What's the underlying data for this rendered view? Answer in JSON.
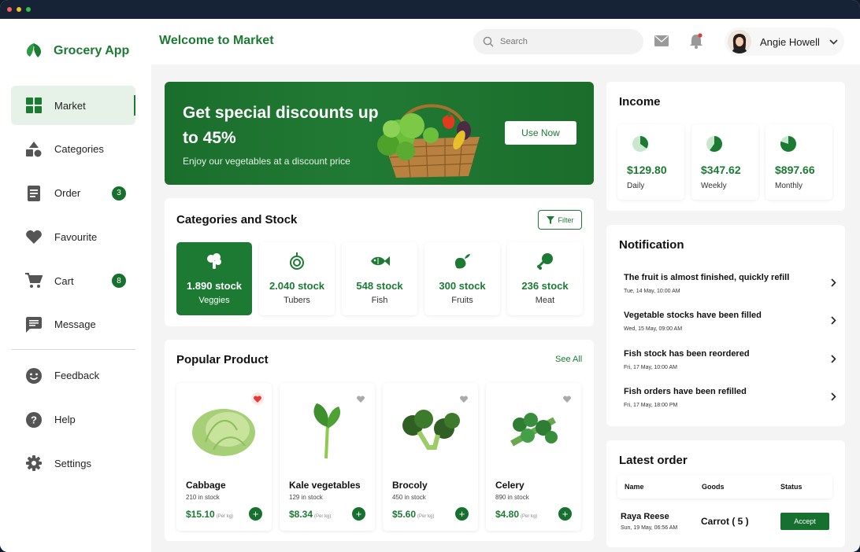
{
  "window": {
    "dots": [
      "#ff5f57",
      "#febc2e",
      "#28c840"
    ]
  },
  "brand": {
    "name": "Grocery App",
    "color": "#1c7a33",
    "logo_icon": "leaf-icon"
  },
  "sidebar": {
    "items": [
      {
        "label": "Market",
        "icon": "grid-icon",
        "active": true
      },
      {
        "label": "Categories",
        "icon": "shapes-icon"
      },
      {
        "label": "Order",
        "icon": "document-icon",
        "badge": "3"
      },
      {
        "label": "Favourite",
        "icon": "heart-icon"
      },
      {
        "label": "Cart",
        "icon": "cart-icon",
        "badge": "8"
      },
      {
        "label": "Message",
        "icon": "message-icon"
      }
    ],
    "bottom_items": [
      {
        "label": "Feedback",
        "icon": "smiley-icon"
      },
      {
        "label": "Help",
        "icon": "help-icon"
      },
      {
        "label": "Settings",
        "icon": "gear-icon"
      }
    ]
  },
  "header": {
    "title": "Welcome to Market",
    "search_placeholder": "Search",
    "user_name": "Angie Howell"
  },
  "banner": {
    "title": "Get special discounts up to 45%",
    "subtitle": "Enjoy our vegetables at a discount price",
    "button": "Use Now"
  },
  "categories": {
    "title": "Categories and Stock",
    "filter_label": "Filter",
    "items": [
      {
        "value": "1.890 stock",
        "name": "Veggies",
        "icon": "broccoli-icon",
        "active": true
      },
      {
        "value": "2.040 stock",
        "name": "Tubers",
        "icon": "onion-icon"
      },
      {
        "value": "548 stock",
        "name": "Fish",
        "icon": "fish-icon"
      },
      {
        "value": "300 stock",
        "name": "Fruits",
        "icon": "apple-icon"
      },
      {
        "value": "236 stock",
        "name": "Meat",
        "icon": "drumstick-icon"
      }
    ]
  },
  "popular": {
    "title": "Popular Product",
    "see_all": "See All",
    "products": [
      {
        "name": "Cabbage",
        "stock": "210 in stock",
        "price": "$15.10",
        "unit": "(Per kg)",
        "favourite": true,
        "image": "cabbage-image"
      },
      {
        "name": "Kale vegetables",
        "stock": "129 in stock",
        "price": "$8.34",
        "unit": "(Per kg)",
        "favourite": false,
        "image": "kale-image"
      },
      {
        "name": "Brocoly",
        "stock": "450 in stock",
        "price": "$5.60",
        "unit": "(Per kg)",
        "favourite": false,
        "image": "broccoli-image"
      },
      {
        "name": "Celery",
        "stock": "890 in stock",
        "price": "$4.80",
        "unit": "(Per kg)",
        "favourite": false,
        "image": "celery-image"
      }
    ]
  },
  "income": {
    "title": "Income",
    "items": [
      {
        "value": "$129.80",
        "label": "Daily",
        "fraction": 0.35
      },
      {
        "value": "$347.62",
        "label": "Weekly",
        "fraction": 0.6
      },
      {
        "value": "$897.66",
        "label": "Monthly",
        "fraction": 0.8
      }
    ]
  },
  "notifications": {
    "title": "Notification",
    "items": [
      {
        "title": "The fruit is almost finished, quickly refill",
        "time": "Tue, 14 May, 10:00 AM"
      },
      {
        "title": "Vegetable stocks have been filled",
        "time": "Wed, 15 May, 09:00 AM"
      },
      {
        "title": "Fish stock has been reordered",
        "time": "Fri, 17 May, 10:00 AM"
      },
      {
        "title": "Fish orders have been refilled",
        "time": "Fri, 17 May, 18:00 PM"
      }
    ]
  },
  "latest_order": {
    "title": "Latest order",
    "columns": [
      "Name",
      "Goods",
      "Status"
    ],
    "rows": [
      {
        "name": "Raya Reese",
        "time": "Sun, 19 May, 06:56 AM",
        "goods": "Carrot ( 5 )",
        "status_button": "Accept"
      }
    ]
  }
}
